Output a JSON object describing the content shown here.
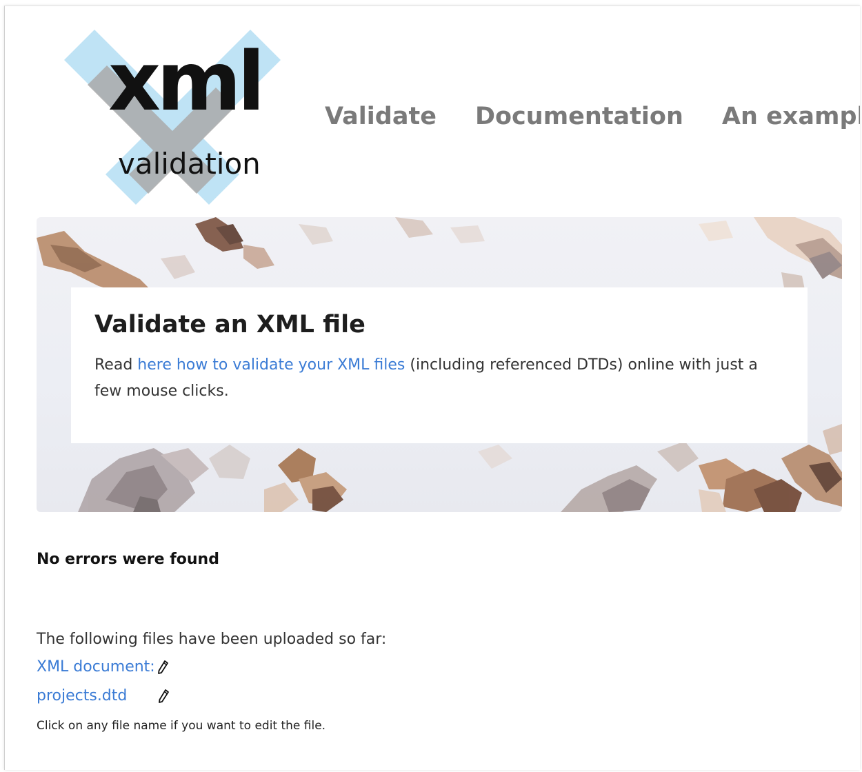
{
  "logo": {
    "word": "xml",
    "subword": "validation",
    "icon": "x-mark-icon",
    "colors": {
      "x_blue": "#bfe3f5",
      "x_gray": "#a9a9a9",
      "text": "#111111"
    }
  },
  "nav": {
    "items": [
      {
        "label": "Validate"
      },
      {
        "label": "Documentation"
      },
      {
        "label": "An example"
      }
    ]
  },
  "hero": {
    "title": "Validate an XML file",
    "text_before": "Read ",
    "link": "here how to validate your XML files",
    "text_after": " (including referenced DTDs) online with just a few mouse clicks."
  },
  "result": {
    "status": "No errors were found",
    "intro": "The following files have been uploaded so far:",
    "files": [
      {
        "name": "XML document:",
        "edit_icon": "pencil-icon"
      },
      {
        "name": "projects.dtd",
        "edit_icon": "pencil-icon"
      }
    ],
    "hint": "Click on any file name if you want to edit the file."
  },
  "colors": {
    "link": "#3a7bd5",
    "nav": "#7a7a7a"
  }
}
